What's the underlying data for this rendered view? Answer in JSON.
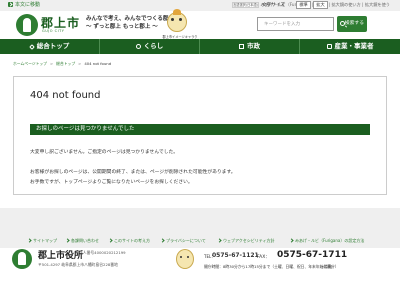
{
  "util": {
    "skip_label": "本文に移動",
    "links": "みあげ・ルビ（Furigana）| 拡大鏡 | 拡大鏡の使い方 | 拡大鏡を使う"
  },
  "header": {
    "city_name": "郡上市",
    "city_sub": "GUJO CITY",
    "slogan_line1": "みんなで考え、みんなでつくる郡上",
    "slogan_line2": "〜 ずっと郡上 もっと郡上 〜",
    "mascot_caption": "郡上市イメージキャラクター 郡上青天ちゃん",
    "lang_label": "言語選択(日本語)",
    "textsize_label": "文字サイズ",
    "size_standard": "標準",
    "size_large": "拡大",
    "search_placeholder": "キーワードを入力",
    "search_button": "検索する"
  },
  "nav": [
    {
      "label": "総合トップ",
      "icon": "home-icon"
    },
    {
      "label": "くらし",
      "icon": "life-icon"
    },
    {
      "label": "市政",
      "icon": "building-icon"
    },
    {
      "label": "産業・事業者",
      "icon": "industry-icon"
    }
  ],
  "breadcrumb": [
    "ホームページトップ",
    "総合トップ",
    "404 not found"
  ],
  "main": {
    "title": "404 not found",
    "notice": "お探しのページは見つかりませんでした",
    "message1": "大変申し訳ございません。ご指定のページは見つかりませんでした。",
    "message2": "お客様がお探しのページは、公開期間の終了、または、ページが削除された可能性があります。",
    "message3": "お手数ですが、トップページよりご覧になりたいページをお探しください。"
  },
  "footer_links": [
    "サイトマップ",
    "各課問い合わせ",
    "このサイトの考え方",
    "プライバシーについて",
    "ウェブアクセシビリティ方針",
    "みあげ・ルビ（Furigana）の設定方法"
  ],
  "footer": {
    "name": "郡上市役所",
    "corp_number": "法人番号4000020212199",
    "address": "〒501-4297 岐阜県郡上市八幡町島谷228番地",
    "tel_label": "TEL：",
    "tel": "0575-67-1121",
    "fax_label": "FAX：",
    "fax": "0575-67-1711",
    "hours": "開庁時間：8時30分から17時15分まで（土曜、日曜、祝日、年末年始は閉庁）",
    "hours_note": "(代表)"
  }
}
